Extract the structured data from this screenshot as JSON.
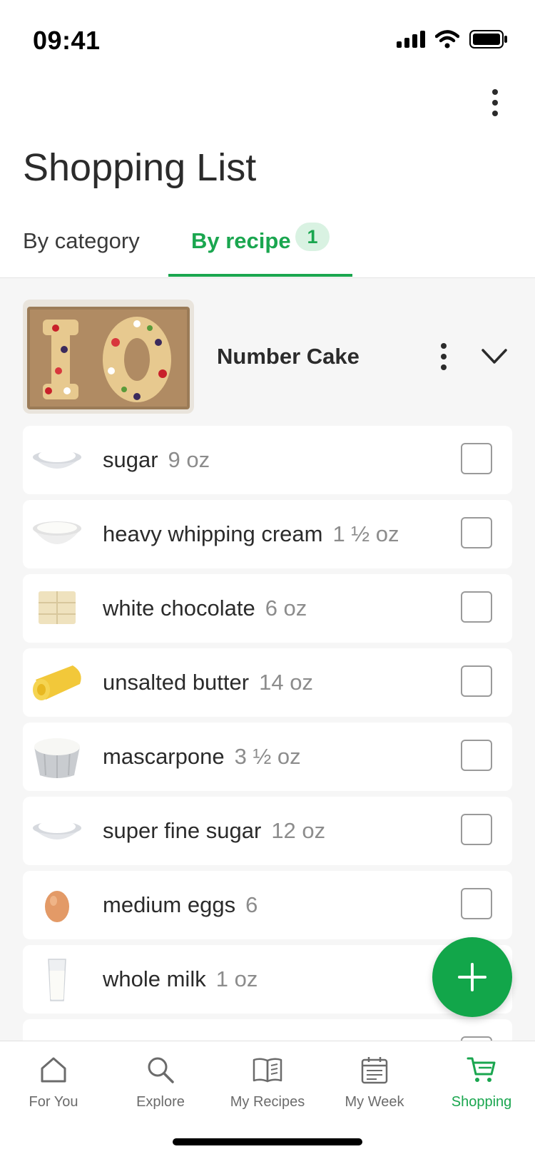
{
  "status_bar": {
    "time": "09:41"
  },
  "header": {
    "title": "Shopping List"
  },
  "tabs": [
    {
      "label": "By category"
    },
    {
      "label": "By recipe",
      "badge": "1"
    }
  ],
  "recipe": {
    "name": "Number Cake"
  },
  "items": [
    {
      "name": "sugar",
      "qty": "9 oz"
    },
    {
      "name": "heavy whipping cream",
      "qty": "1 ½ oz"
    },
    {
      "name": "white chocolate",
      "qty": "6 oz"
    },
    {
      "name": "unsalted butter",
      "qty": "14 oz"
    },
    {
      "name": "mascarpone",
      "qty": "3 ½ oz"
    },
    {
      "name": "super fine sugar",
      "qty": "12 oz"
    },
    {
      "name": "medium eggs",
      "qty": "6"
    },
    {
      "name": "whole milk",
      "qty": "1 oz"
    }
  ],
  "nav": [
    {
      "label": "For You",
      "icon": "home-icon"
    },
    {
      "label": "Explore",
      "icon": "search-icon"
    },
    {
      "label": "My Recipes",
      "icon": "book-icon"
    },
    {
      "label": "My Week",
      "icon": "calendar-icon"
    },
    {
      "label": "Shopping",
      "icon": "cart-icon"
    }
  ],
  "colors": {
    "accent": "#1aa64f",
    "fab": "#12a64a"
  }
}
